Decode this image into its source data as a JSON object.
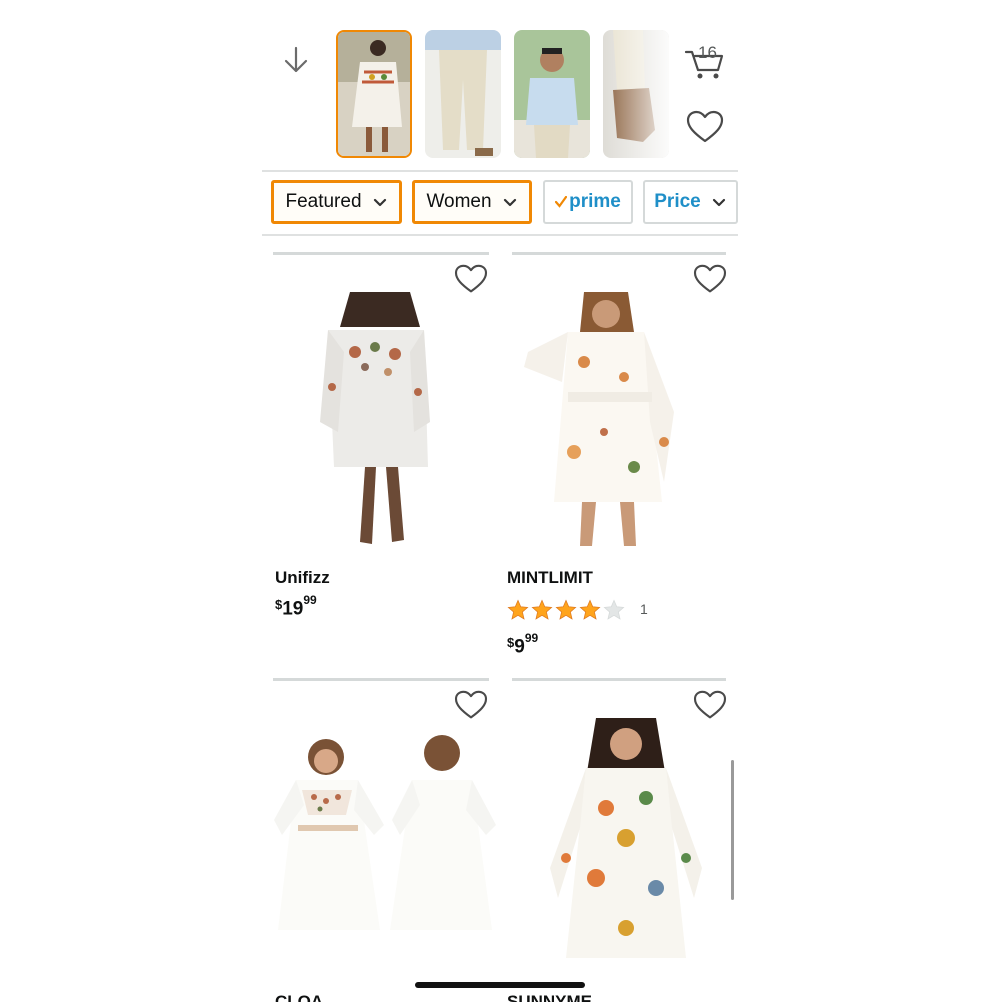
{
  "header": {
    "cart_count": "16",
    "thumbnails": [
      {
        "name": "woman-embroidered-dress-thumbnail",
        "selected": true
      },
      {
        "name": "man-khaki-pants-thumbnail",
        "selected": false
      },
      {
        "name": "man-blue-shirt-thumbnail",
        "selected": false
      },
      {
        "name": "brown-shoe-thumbnail",
        "selected": false
      }
    ]
  },
  "filters": {
    "featured": "Featured",
    "women": "Women",
    "prime": "prime",
    "price": "Price"
  },
  "products": [
    {
      "brand": "Unifizz",
      "price_currency": "$",
      "price_whole": "19",
      "price_fraction": "99"
    },
    {
      "brand": "MINTLIMIT",
      "rating": 4,
      "rating_max": 5,
      "rating_count": "1",
      "price_currency": "$",
      "price_whole": "9",
      "price_fraction": "99"
    },
    {
      "brand": "CLOA"
    },
    {
      "brand": "SUNNYME"
    }
  ],
  "colors": {
    "accent_orange": "#f08804",
    "prime_blue": "#1f8fc8",
    "star": "#ffa41c"
  }
}
